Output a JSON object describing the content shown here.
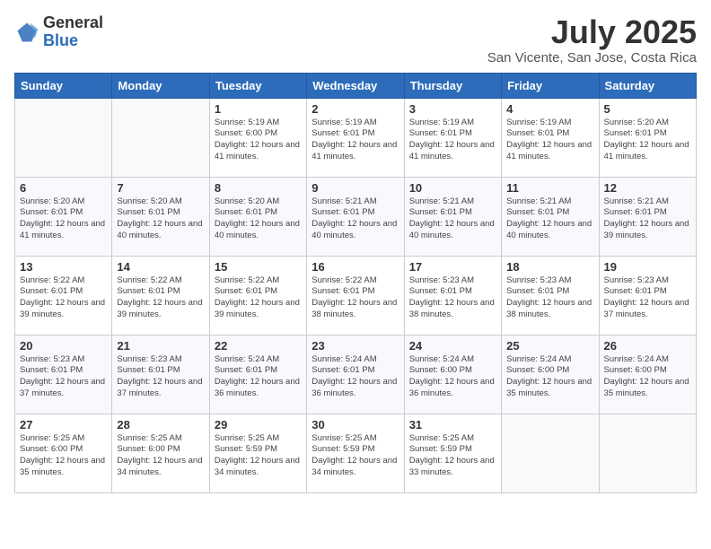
{
  "header": {
    "logo_general": "General",
    "logo_blue": "Blue",
    "title": "July 2025",
    "subtitle": "San Vicente, San Jose, Costa Rica"
  },
  "days_of_week": [
    "Sunday",
    "Monday",
    "Tuesday",
    "Wednesday",
    "Thursday",
    "Friday",
    "Saturday"
  ],
  "weeks": [
    [
      {
        "num": "",
        "info": ""
      },
      {
        "num": "",
        "info": ""
      },
      {
        "num": "1",
        "info": "Sunrise: 5:19 AM\nSunset: 6:00 PM\nDaylight: 12 hours and 41 minutes."
      },
      {
        "num": "2",
        "info": "Sunrise: 5:19 AM\nSunset: 6:01 PM\nDaylight: 12 hours and 41 minutes."
      },
      {
        "num": "3",
        "info": "Sunrise: 5:19 AM\nSunset: 6:01 PM\nDaylight: 12 hours and 41 minutes."
      },
      {
        "num": "4",
        "info": "Sunrise: 5:19 AM\nSunset: 6:01 PM\nDaylight: 12 hours and 41 minutes."
      },
      {
        "num": "5",
        "info": "Sunrise: 5:20 AM\nSunset: 6:01 PM\nDaylight: 12 hours and 41 minutes."
      }
    ],
    [
      {
        "num": "6",
        "info": "Sunrise: 5:20 AM\nSunset: 6:01 PM\nDaylight: 12 hours and 41 minutes."
      },
      {
        "num": "7",
        "info": "Sunrise: 5:20 AM\nSunset: 6:01 PM\nDaylight: 12 hours and 40 minutes."
      },
      {
        "num": "8",
        "info": "Sunrise: 5:20 AM\nSunset: 6:01 PM\nDaylight: 12 hours and 40 minutes."
      },
      {
        "num": "9",
        "info": "Sunrise: 5:21 AM\nSunset: 6:01 PM\nDaylight: 12 hours and 40 minutes."
      },
      {
        "num": "10",
        "info": "Sunrise: 5:21 AM\nSunset: 6:01 PM\nDaylight: 12 hours and 40 minutes."
      },
      {
        "num": "11",
        "info": "Sunrise: 5:21 AM\nSunset: 6:01 PM\nDaylight: 12 hours and 40 minutes."
      },
      {
        "num": "12",
        "info": "Sunrise: 5:21 AM\nSunset: 6:01 PM\nDaylight: 12 hours and 39 minutes."
      }
    ],
    [
      {
        "num": "13",
        "info": "Sunrise: 5:22 AM\nSunset: 6:01 PM\nDaylight: 12 hours and 39 minutes."
      },
      {
        "num": "14",
        "info": "Sunrise: 5:22 AM\nSunset: 6:01 PM\nDaylight: 12 hours and 39 minutes."
      },
      {
        "num": "15",
        "info": "Sunrise: 5:22 AM\nSunset: 6:01 PM\nDaylight: 12 hours and 39 minutes."
      },
      {
        "num": "16",
        "info": "Sunrise: 5:22 AM\nSunset: 6:01 PM\nDaylight: 12 hours and 38 minutes."
      },
      {
        "num": "17",
        "info": "Sunrise: 5:23 AM\nSunset: 6:01 PM\nDaylight: 12 hours and 38 minutes."
      },
      {
        "num": "18",
        "info": "Sunrise: 5:23 AM\nSunset: 6:01 PM\nDaylight: 12 hours and 38 minutes."
      },
      {
        "num": "19",
        "info": "Sunrise: 5:23 AM\nSunset: 6:01 PM\nDaylight: 12 hours and 37 minutes."
      }
    ],
    [
      {
        "num": "20",
        "info": "Sunrise: 5:23 AM\nSunset: 6:01 PM\nDaylight: 12 hours and 37 minutes."
      },
      {
        "num": "21",
        "info": "Sunrise: 5:23 AM\nSunset: 6:01 PM\nDaylight: 12 hours and 37 minutes."
      },
      {
        "num": "22",
        "info": "Sunrise: 5:24 AM\nSunset: 6:01 PM\nDaylight: 12 hours and 36 minutes."
      },
      {
        "num": "23",
        "info": "Sunrise: 5:24 AM\nSunset: 6:01 PM\nDaylight: 12 hours and 36 minutes."
      },
      {
        "num": "24",
        "info": "Sunrise: 5:24 AM\nSunset: 6:00 PM\nDaylight: 12 hours and 36 minutes."
      },
      {
        "num": "25",
        "info": "Sunrise: 5:24 AM\nSunset: 6:00 PM\nDaylight: 12 hours and 35 minutes."
      },
      {
        "num": "26",
        "info": "Sunrise: 5:24 AM\nSunset: 6:00 PM\nDaylight: 12 hours and 35 minutes."
      }
    ],
    [
      {
        "num": "27",
        "info": "Sunrise: 5:25 AM\nSunset: 6:00 PM\nDaylight: 12 hours and 35 minutes."
      },
      {
        "num": "28",
        "info": "Sunrise: 5:25 AM\nSunset: 6:00 PM\nDaylight: 12 hours and 34 minutes."
      },
      {
        "num": "29",
        "info": "Sunrise: 5:25 AM\nSunset: 5:59 PM\nDaylight: 12 hours and 34 minutes."
      },
      {
        "num": "30",
        "info": "Sunrise: 5:25 AM\nSunset: 5:59 PM\nDaylight: 12 hours and 34 minutes."
      },
      {
        "num": "31",
        "info": "Sunrise: 5:25 AM\nSunset: 5:59 PM\nDaylight: 12 hours and 33 minutes."
      },
      {
        "num": "",
        "info": ""
      },
      {
        "num": "",
        "info": ""
      }
    ]
  ]
}
